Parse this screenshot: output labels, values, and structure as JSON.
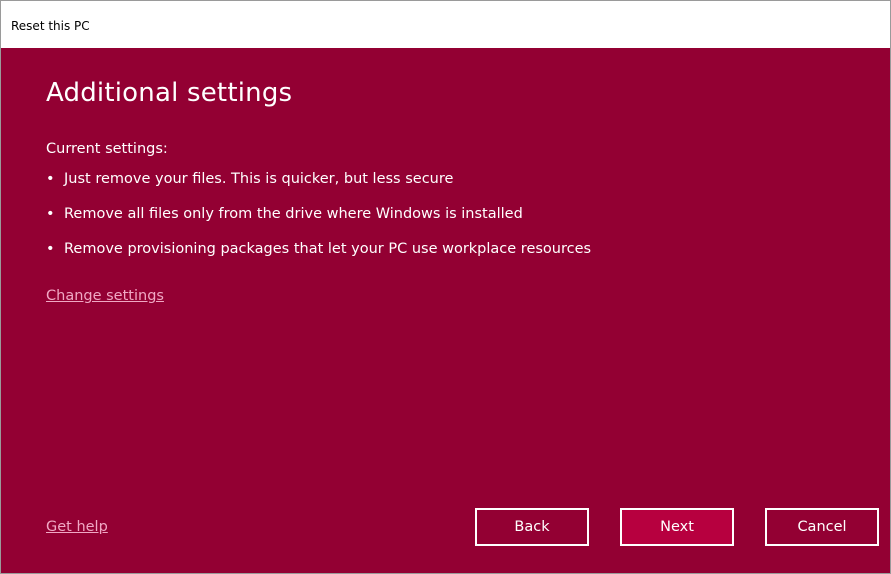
{
  "window": {
    "title": "Reset this PC"
  },
  "main": {
    "heading": "Additional settings",
    "current_settings_label": "Current settings:",
    "bullets": [
      "Just remove your files. This is quicker, but less secure",
      "Remove all files only from the drive where Windows is installed",
      "Remove provisioning packages that let your PC use workplace resources"
    ],
    "change_settings_link": "Change settings"
  },
  "footer": {
    "get_help_link": "Get help",
    "back_label": "Back",
    "next_label": "Next",
    "cancel_label": "Cancel"
  },
  "colors": {
    "background": "#930033",
    "link": "#f0a8c4",
    "primary_button": "#b7003f"
  }
}
